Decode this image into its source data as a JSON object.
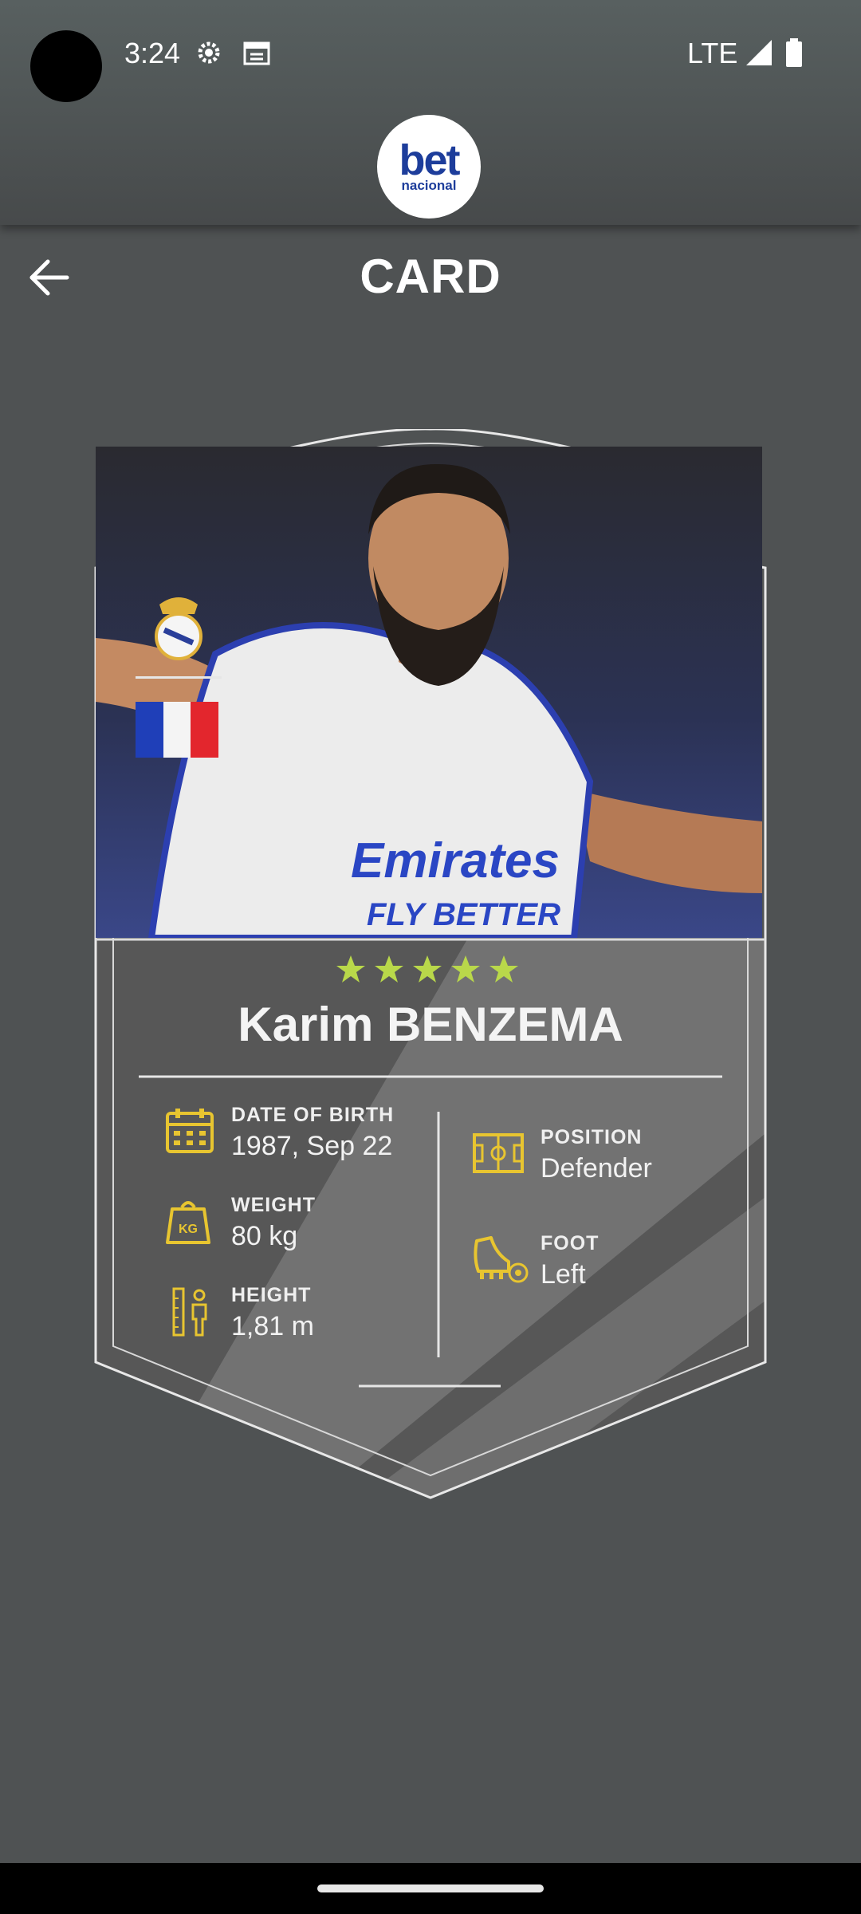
{
  "status_bar": {
    "time": "3:24",
    "network": "LTE"
  },
  "header": {
    "logo_main": "bet",
    "logo_sub": "nacional"
  },
  "page": {
    "title": "CARD"
  },
  "player": {
    "name": "Karim BENZEMA",
    "stars": 5,
    "club": "Real Madrid crest",
    "nationality_flag": "France",
    "stats": {
      "date_of_birth": {
        "label": "DATE OF BIRTH",
        "value": "1987, Sep 22"
      },
      "weight": {
        "label": "WEIGHT",
        "value": "80 kg",
        "icon_text": "KG"
      },
      "height": {
        "label": "HEIGHT",
        "value": "1,81 m"
      },
      "position": {
        "label": "POSITION",
        "value": "Defender"
      },
      "foot": {
        "label": "FOOT",
        "value": "Left"
      }
    }
  },
  "colors": {
    "background": "#4f5253",
    "accent_gold": "#e8c530",
    "star_green": "#b9d84a",
    "logo_blue": "#1d3d9b"
  }
}
